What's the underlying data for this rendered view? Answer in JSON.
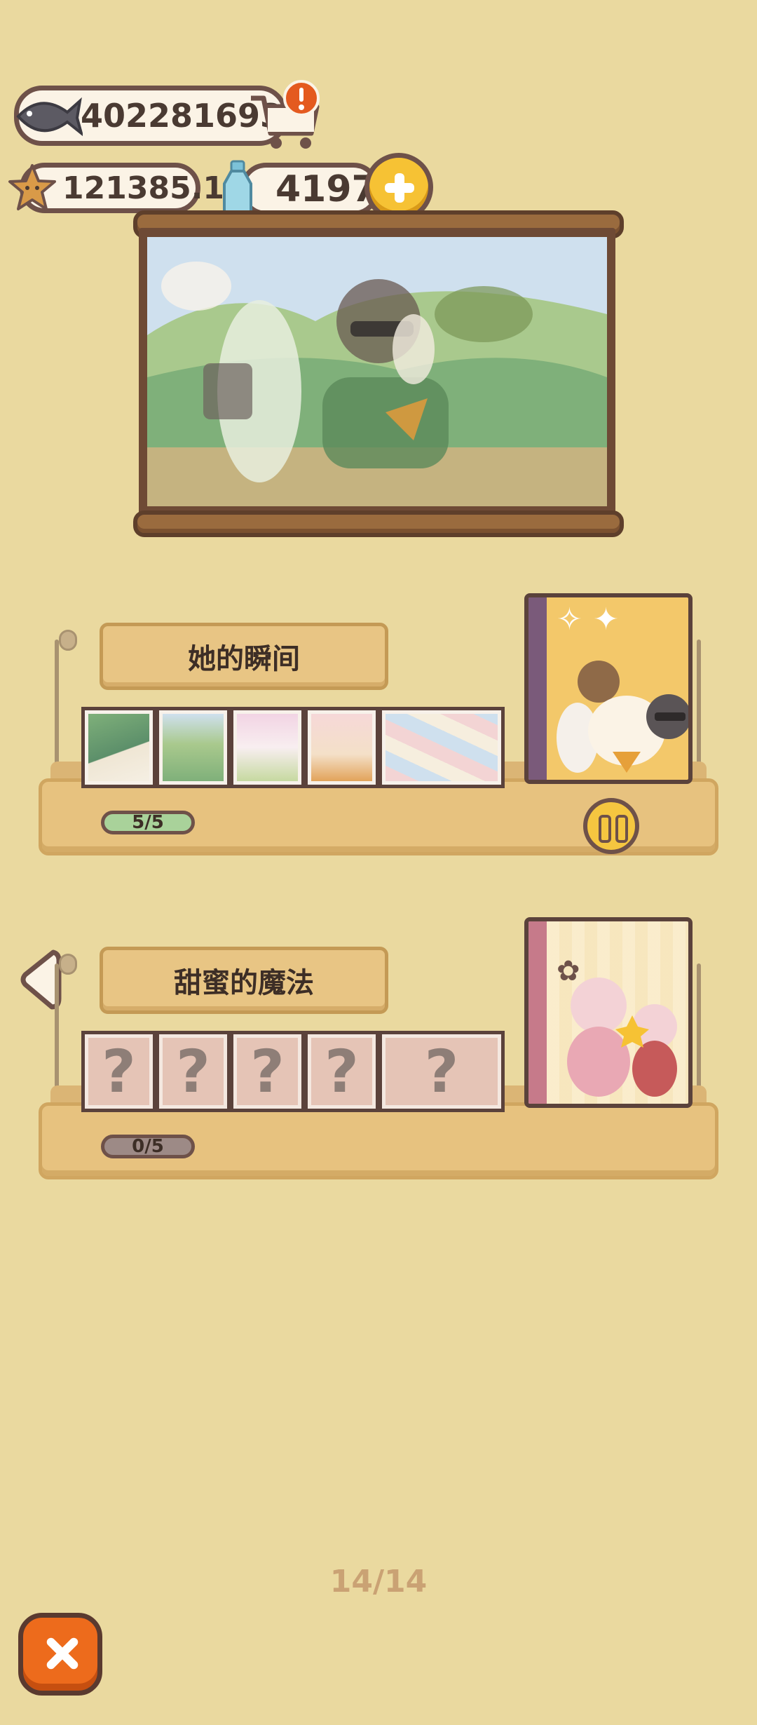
{
  "currency": {
    "fish": "402281693",
    "stars": "121385.1",
    "bottles": "4197"
  },
  "shelves": [
    {
      "title": "她的瞬间",
      "progress": "5/5",
      "unknown_mark": "?"
    },
    {
      "title": "甜蜜的魔法",
      "progress": "0/5",
      "unknown_mark": "?"
    }
  ],
  "page_indicator": "14/14",
  "icons": [
    "fish-icon",
    "shop-cart-icon",
    "alert-icon",
    "star-icon",
    "bottle-icon",
    "plus-icon",
    "pause-icon",
    "left-arrow-icon",
    "close-icon"
  ],
  "colors": {
    "background": "#ead99f",
    "accent_orange": "#ed6b1c",
    "accent_yellow": "#f6c234",
    "border_brown": "#6e5149"
  }
}
